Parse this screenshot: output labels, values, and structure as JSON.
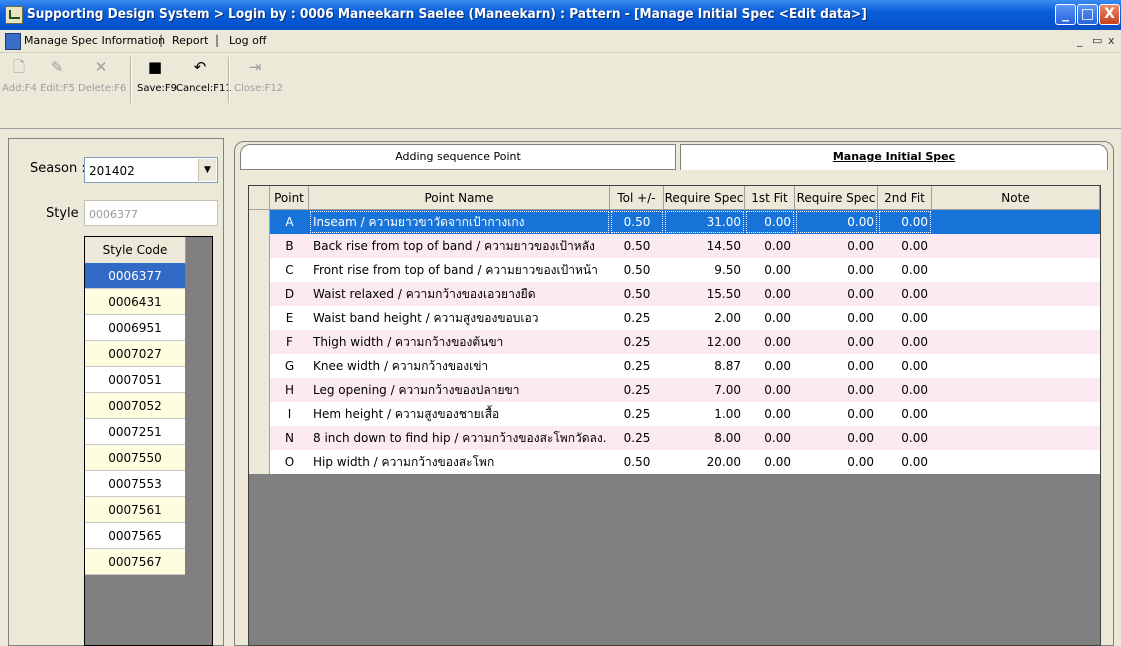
{
  "window": {
    "title": "Supporting Design System > Login by : 0006  Maneekarn Saelee  (Maneekarn) : Pattern - [Manage Initial Spec  <Edit data>]",
    "controls": [
      "minimize-icon",
      "maximize-icon",
      "close-icon"
    ]
  },
  "menu": {
    "items": [
      "Manage Spec Information",
      "Report",
      "Log off"
    ],
    "separator": "|",
    "mdi_controls": [
      "_",
      "ᵇ",
      "x"
    ]
  },
  "toolbar": {
    "buttons": [
      {
        "label": "Add:F4",
        "icon": "new-document-icon",
        "enabled": false
      },
      {
        "label": "Edit:F5",
        "icon": "edit-folder-icon",
        "enabled": false
      },
      {
        "label": "Delete:F6",
        "icon": "delete-x-icon",
        "enabled": false
      },
      {
        "label": "Save:F9",
        "icon": "save-disk-icon",
        "enabled": true
      },
      {
        "label": "Cancel:F11",
        "icon": "undo-icon",
        "enabled": true
      },
      {
        "label": "Close:F12",
        "icon": "exit-door-icon",
        "enabled": false
      }
    ]
  },
  "left": {
    "season_label": "Season :",
    "season_value": "201402",
    "style_label": "Style :",
    "style_value": "0006377",
    "style_code_header": "Style Code",
    "style_codes": [
      "0006377",
      "0006431",
      "0006951",
      "0007027",
      "0007051",
      "0007052",
      "0007251",
      "0007550",
      "0007553",
      "0007561",
      "0007565",
      "0007567"
    ],
    "selected_index": 0
  },
  "tabs": {
    "tab1": "Adding sequence Point",
    "tab2": "Manage Initial Spec"
  },
  "grid": {
    "columns": [
      "Point",
      "Point Name",
      "Tol +/-",
      "Require Spec",
      "1st Fit",
      "Require Spec",
      "2nd Fit",
      "Note"
    ],
    "rows": [
      {
        "point": "A",
        "name": "Inseam / ความยาวขาวัดจากเป้ากางเกง",
        "tol": "0.50",
        "req1": "31.00",
        "fit1": "0.00",
        "req2": "0.00",
        "fit2": "0.00",
        "note": ""
      },
      {
        "point": "B",
        "name": "Back rise from top of band / ความยาวของเป้าหลัง",
        "tol": "0.50",
        "req1": "14.50",
        "fit1": "0.00",
        "req2": "0.00",
        "fit2": "0.00",
        "note": ""
      },
      {
        "point": "C",
        "name": "Front rise from top of band / ความยาวของเป้าหน้า",
        "tol": "0.50",
        "req1": "9.50",
        "fit1": "0.00",
        "req2": "0.00",
        "fit2": "0.00",
        "note": ""
      },
      {
        "point": "D",
        "name": "Waist relaxed / ความกว้างของเอวยางยืด",
        "tol": "0.50",
        "req1": "15.50",
        "fit1": "0.00",
        "req2": "0.00",
        "fit2": "0.00",
        "note": ""
      },
      {
        "point": "E",
        "name": "Waist band height / ความสูงของขอบเอว",
        "tol": "0.25",
        "req1": "2.00",
        "fit1": "0.00",
        "req2": "0.00",
        "fit2": "0.00",
        "note": ""
      },
      {
        "point": "F",
        "name": "Thigh width / ความกว้างของต้นขา",
        "tol": "0.25",
        "req1": "12.00",
        "fit1": "0.00",
        "req2": "0.00",
        "fit2": "0.00",
        "note": ""
      },
      {
        "point": "G",
        "name": "Knee width / ความกว้างของเข่า",
        "tol": "0.25",
        "req1": "8.87",
        "fit1": "0.00",
        "req2": "0.00",
        "fit2": "0.00",
        "note": ""
      },
      {
        "point": "H",
        "name": "Leg opening / ความกว้างของปลายขา",
        "tol": "0.25",
        "req1": "7.00",
        "fit1": "0.00",
        "req2": "0.00",
        "fit2": "0.00",
        "note": ""
      },
      {
        "point": "I",
        "name": "Hem height  / ความสูงของชายเสื้อ",
        "tol": "0.25",
        "req1": "1.00",
        "fit1": "0.00",
        "req2": "0.00",
        "fit2": "0.00",
        "note": ""
      },
      {
        "point": "N",
        "name": "8 inch down to find hip / ความกว้างของสะโพกวัดลง.",
        "tol": "0.25",
        "req1": "8.00",
        "fit1": "0.00",
        "req2": "0.00",
        "fit2": "0.00",
        "note": ""
      },
      {
        "point": "O",
        "name": "Hip width / ความกว้างของสะโพก",
        "tol": "0.50",
        "req1": "20.00",
        "fit1": "0.00",
        "req2": "0.00",
        "fit2": "0.00",
        "note": ""
      }
    ],
    "selected_row": 0,
    "colors": {
      "selected": "#1874d8",
      "alt": "#fbeaf2",
      "normal": "#ffffff",
      "empty": "#808080"
    }
  },
  "colors": {
    "titlebar": "#0a5fd8",
    "face": "#ece9d8",
    "selection": "#316ac5",
    "list_alt": "#fffde0"
  }
}
